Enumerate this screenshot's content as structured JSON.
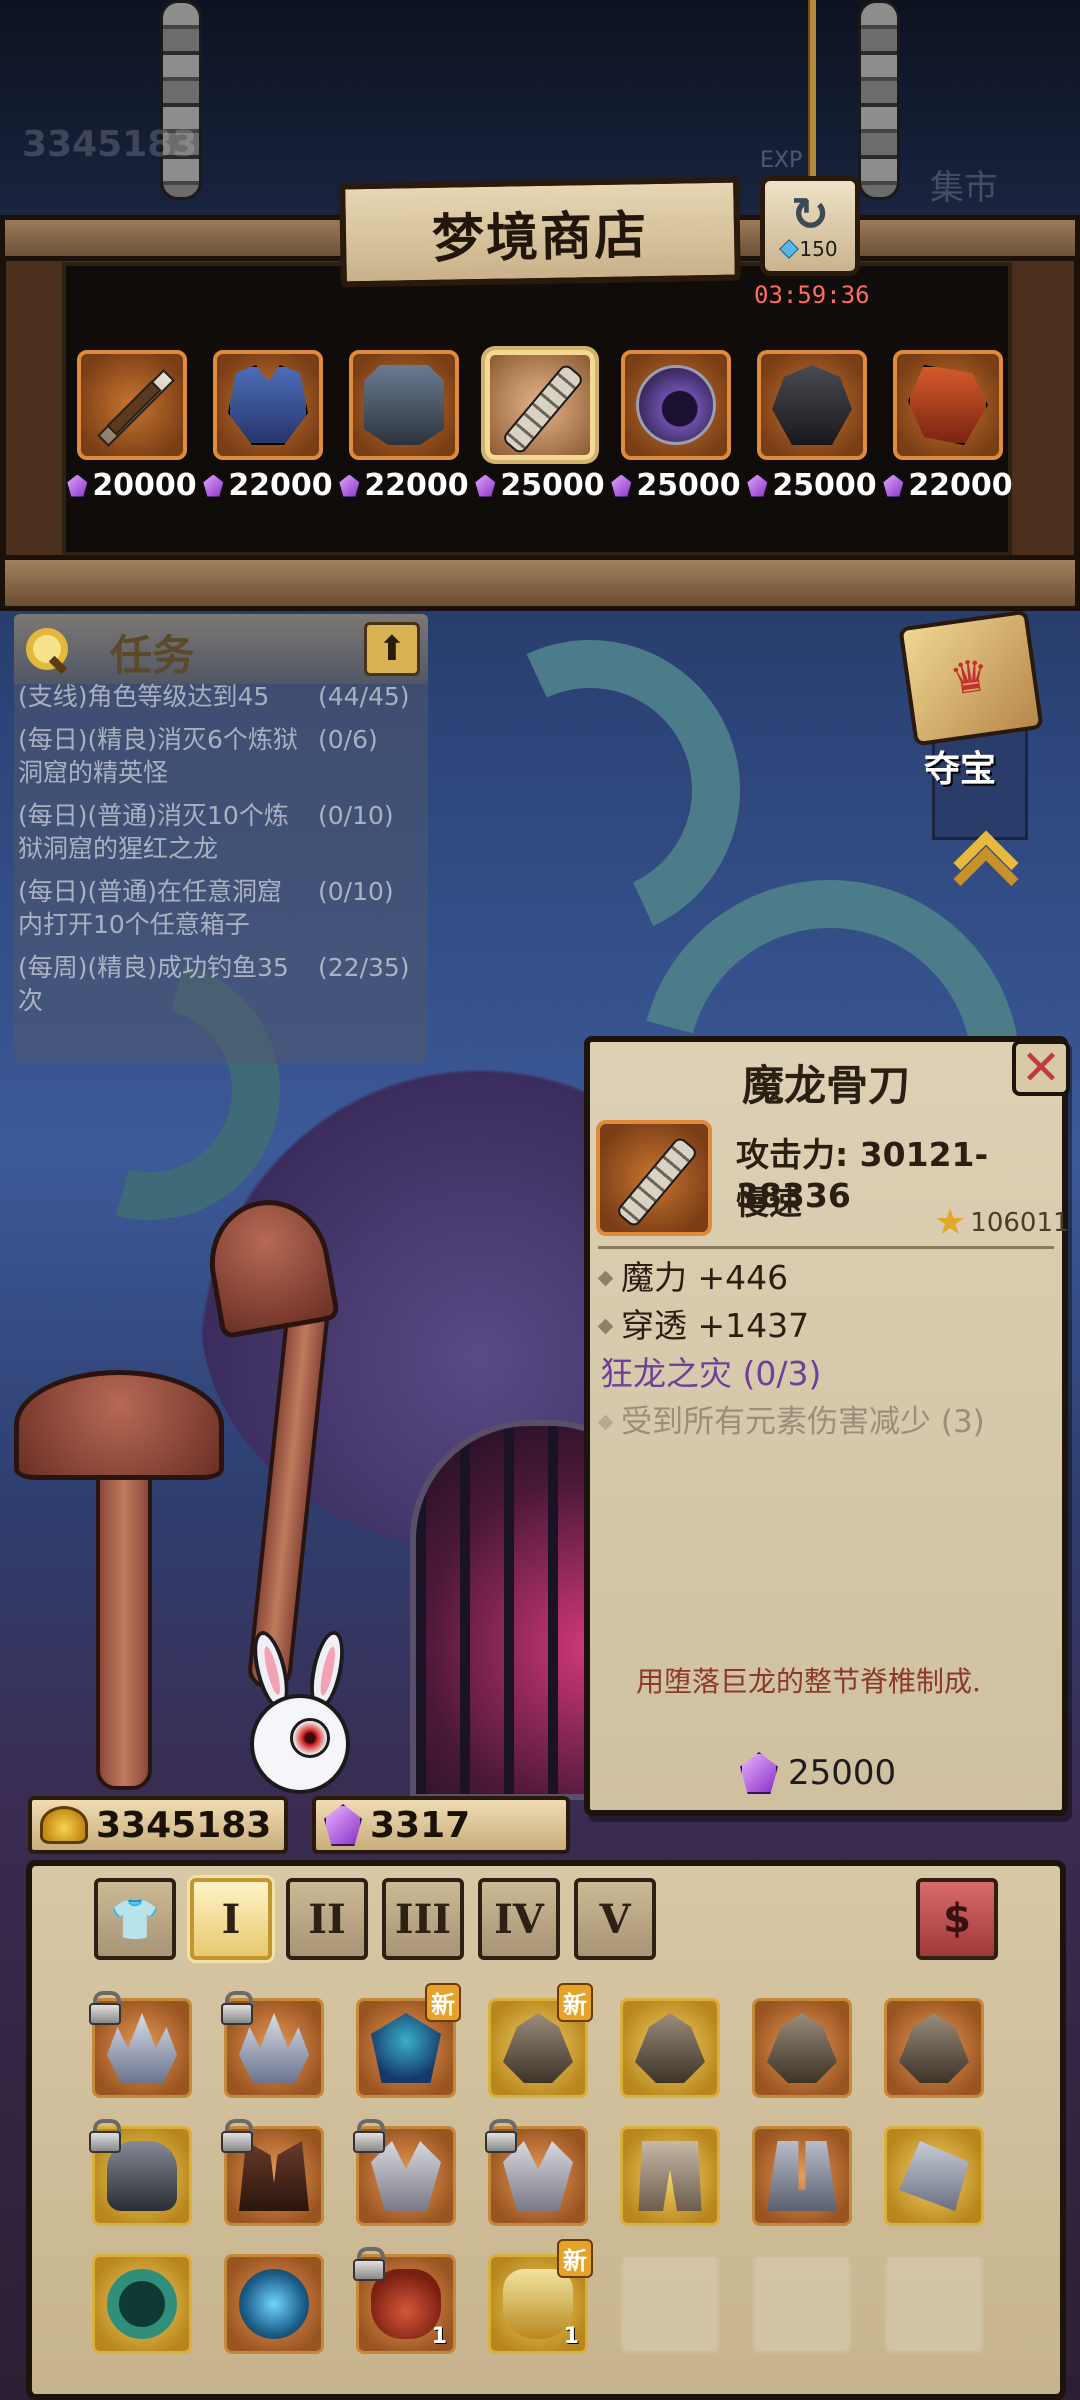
{
  "hud": {
    "gold_ghost": "3345183",
    "exp_label": "EXP",
    "market_label": "集市"
  },
  "shop": {
    "title": "梦境商店",
    "refresh_cost": "150",
    "timer": "03:59:36",
    "items": [
      {
        "icon": "crossbow-sword-icon",
        "price": "20000"
      },
      {
        "icon": "spiked-armor-icon",
        "price": "22000"
      },
      {
        "icon": "dark-helmet-icon",
        "price": "22000"
      },
      {
        "icon": "bone-blade-icon",
        "price": "25000",
        "selected": true
      },
      {
        "icon": "void-hood-icon",
        "price": "25000"
      },
      {
        "icon": "dark-chest-icon",
        "price": "25000"
      },
      {
        "icon": "crimson-gauntlet-icon",
        "price": "22000"
      }
    ]
  },
  "quests": {
    "title": "任务",
    "items": [
      {
        "text": "(支线)角色等级达到45",
        "progress": "(44/45)"
      },
      {
        "text": "(每日)(精良)消灭6个炼狱洞窟的精英怪",
        "progress": "(0/6)"
      },
      {
        "text": "(每日)(普通)消灭10个炼狱洞窟的猩红之龙",
        "progress": "(0/10)"
      },
      {
        "text": "(每日)(普通)在任意洞窟内打开10个任意箱子",
        "progress": "(0/10)"
      },
      {
        "text": "(每周)(精良)成功钓鱼35次",
        "progress": "(22/35)"
      }
    ]
  },
  "treasure": {
    "label": "夺宝"
  },
  "detail": {
    "title": "魔龙骨刀",
    "attack": "攻击力: 30121-38336",
    "speed": "慢速",
    "score": "106011",
    "stats": [
      "魔力 +446",
      "穿透 +1437"
    ],
    "set_name": "狂龙之灾 (0/3)",
    "set_bonus": "受到所有元素伤害减少 (3)",
    "description": "用堕落巨龙的整节脊椎制成.",
    "price": "25000"
  },
  "currency": {
    "gold": "3345183",
    "gems": "3317"
  },
  "inventory": {
    "tabs": [
      "👕",
      "I",
      "II",
      "III",
      "IV",
      "V"
    ],
    "active_tab": 1,
    "sort_label": "$",
    "new_badge": "新",
    "cells": [
      {
        "icon": "c-tiara",
        "locked": true
      },
      {
        "icon": "c-tiara",
        "locked": true
      },
      {
        "icon": "c-mask",
        "new": true
      },
      {
        "icon": "c-q",
        "new": true,
        "gold": true
      },
      {
        "icon": "c-q",
        "gold": true
      },
      {
        "icon": "c-q"
      },
      {
        "icon": "c-q"
      },
      {
        "icon": "c-knight",
        "locked": true,
        "gold": true
      },
      {
        "icon": "c-beast",
        "locked": true
      },
      {
        "icon": "c-wings",
        "locked": true
      },
      {
        "icon": "c-wings",
        "locked": true
      },
      {
        "icon": "c-legs",
        "gold": true
      },
      {
        "icon": "c-boots"
      },
      {
        "icon": "c-glove",
        "gold": true
      },
      {
        "icon": "c-ring",
        "gold": true
      },
      {
        "icon": "c-amulet"
      },
      {
        "icon": "c-bag",
        "locked": true,
        "qty": "1"
      },
      {
        "icon": "c-potion",
        "new": true,
        "gold": true,
        "qty": "1"
      },
      {
        "icon": "",
        "empty": true
      },
      {
        "icon": "",
        "empty": true
      },
      {
        "icon": "",
        "empty": true
      }
    ]
  }
}
